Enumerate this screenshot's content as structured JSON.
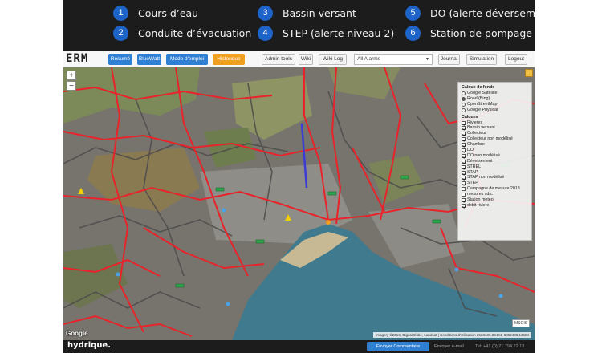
{
  "legend": [
    {
      "num": "1",
      "label": "Cours d’eau"
    },
    {
      "num": "2",
      "label": "Conduite d’évacuation"
    },
    {
      "num": "3",
      "label": "Bassin versant"
    },
    {
      "num": "4",
      "label": "STEP (alerte niveau 2)"
    },
    {
      "num": "5",
      "label": "DO (alerte déversement)"
    },
    {
      "num": "6",
      "label": "Station de pompage"
    }
  ],
  "toolbar": {
    "logo": "ERM",
    "tabs": [
      "Résumé",
      "BlueWatt",
      "Mode d'emploi",
      "Historique"
    ],
    "admin_tools": "Admin tools",
    "wiki": "Wiki",
    "wiki_log": "Wiki Log",
    "alarms_select": "All Alarms",
    "journal": "Journal",
    "simulation": "Simulation",
    "logout": "Logout"
  },
  "map": {
    "zoom_in": "+",
    "zoom_out": "−",
    "google_watermark": "Google",
    "attribution": "Imagery ©2016, DigitalGlobe, Landsat | Conditions d'utilisation",
    "coords": "2533136,89404, 6862408,13684",
    "scale": "MSGIS"
  },
  "layers": {
    "base_title": "Calque de fonds",
    "base_options": [
      {
        "label": "Google Satellite",
        "selected": false
      },
      {
        "label": "Road (Bing)",
        "selected": true
      },
      {
        "label": "OpenStreetMap",
        "selected": false
      },
      {
        "label": "Google Physical",
        "selected": false
      }
    ],
    "overlay_title": "Calques",
    "overlays": [
      {
        "label": "Rivieres",
        "checked": true
      },
      {
        "label": "Bassin versant",
        "checked": true
      },
      {
        "label": "Collecteur",
        "checked": true
      },
      {
        "label": "Collecteur non modélisé",
        "checked": true
      },
      {
        "label": "Chambre",
        "checked": true
      },
      {
        "label": "DO",
        "checked": true
      },
      {
        "label": "DO non modélisé",
        "checked": true
      },
      {
        "label": "Déversement",
        "checked": true
      },
      {
        "label": "STREL",
        "checked": true
      },
      {
        "label": "STAP",
        "checked": true
      },
      {
        "label": "STAP non modélisé",
        "checked": true
      },
      {
        "label": "STEP",
        "checked": true
      },
      {
        "label": "Campagne de mesure 2013",
        "checked": false
      },
      {
        "label": "mesures sdrc",
        "checked": false
      },
      {
        "label": "Station meteo",
        "checked": true
      },
      {
        "label": "debit riviere",
        "checked": true
      }
    ]
  },
  "footer": {
    "brand": "hydrique.",
    "send_comment": "Envoyer Commentaire",
    "send_mail": "Envoyer e-mail",
    "phone": "Tel: +41 (0) 21 794 22 13"
  },
  "colors": {
    "accent_blue": "#1e63c8",
    "button_blue": "#2f7fd3",
    "button_orange": "#f0a020",
    "river_red": "#e8232a",
    "header_dark": "#1c1c1c",
    "lake": "#3f7a8e"
  }
}
